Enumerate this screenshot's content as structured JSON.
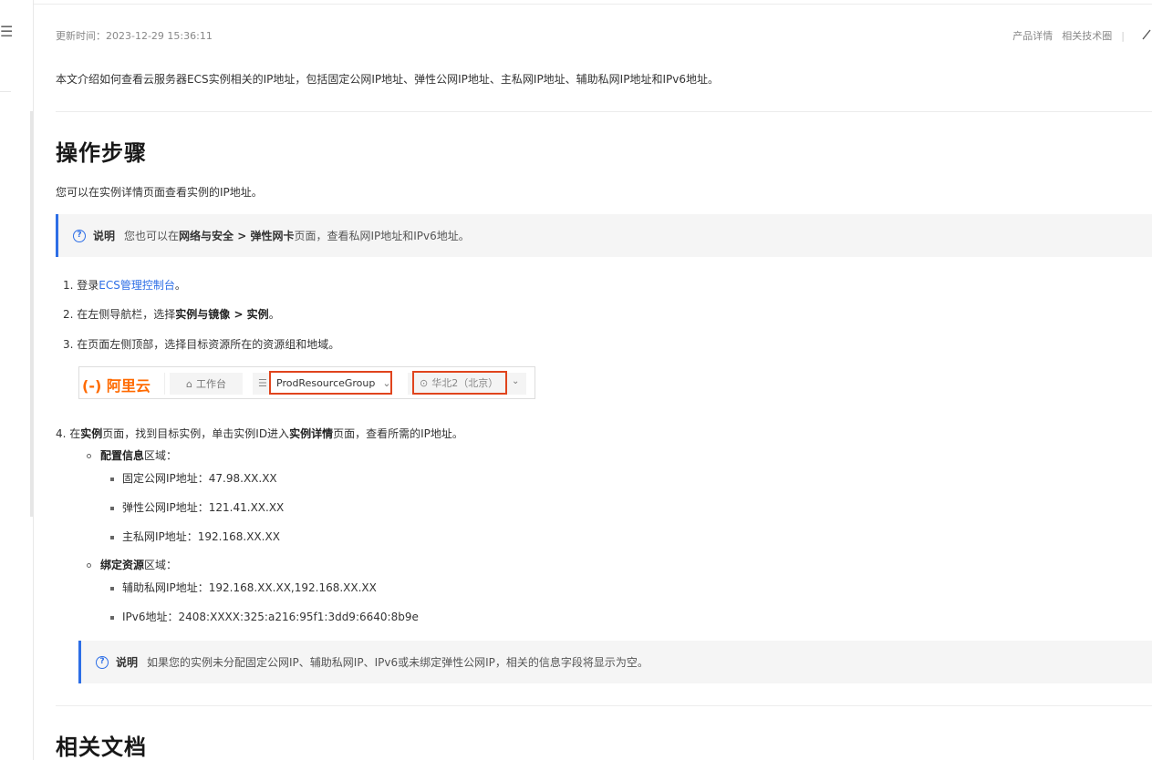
{
  "header": {
    "update_time": "更新时间：2023-12-29 15:36:11",
    "links": [
      "产品详情",
      "相关技术圈"
    ]
  },
  "intro": "本文介绍如何查看云服务器ECS实例相关的IP地址，包括固定公网IP地址、弹性公网IP地址、主私网IP地址、辅助私网IP地址和IPv6地址。",
  "section1": {
    "title": "操作步骤",
    "desc": "您可以在实例详情页面查看实例的IP地址。"
  },
  "note1": {
    "title": "说明",
    "pre": "您也可以在",
    "bold": "网络与安全 > 弹性网卡",
    "post": "页面，查看私网IP地址和IPv6地址。"
  },
  "steps": {
    "s1_pre": "1. 登录",
    "s1_link": "ECS管理控制台",
    "s1_post": "。",
    "s2_pre": "2. 在左侧导航栏，选择",
    "s2_bold": "实例与镜像 > 实例",
    "s2_post": "。",
    "s3": "3. 在页面左侧顶部，选择目标资源所在的资源组和地域。",
    "s4_a": "4. 在",
    "s4_b": "实例",
    "s4_c": "页面，找到目标实例，单击实例ID进入",
    "s4_d": "实例详情",
    "s4_e": "页面，查看所需的IP地址。"
  },
  "screenshot": {
    "logo": "(-) 阿里云",
    "workbench": "工作台",
    "resource_group": "ProdResourceGroup",
    "region": "华北2（北京）"
  },
  "config_area": {
    "label_bold": "配置信息",
    "label_rest": "区域：",
    "items": [
      "固定公网IP地址：47.98.XX.XX",
      "弹性公网IP地址：121.41.XX.XX",
      "主私网IP地址：192.168.XX.XX"
    ]
  },
  "bind_area": {
    "label_bold": "绑定资源",
    "label_rest": "区域：",
    "items": [
      "辅助私网IP地址：192.168.XX.XX,192.168.XX.XX",
      "IPv6地址：2408:XXXX:325:a216:95f1:3dd9:6640:8b9e"
    ]
  },
  "note2": {
    "title": "说明",
    "text": "如果您的实例未分配固定公网IP、辅助私网IP、IPv6或未绑定弹性公网IP，相关的信息字段将显示为空。"
  },
  "section2": {
    "title": "相关文档"
  },
  "colors": {
    "accent": "#2d6ee6",
    "highlight": "#e0441d",
    "brand": "#ff6a00"
  }
}
